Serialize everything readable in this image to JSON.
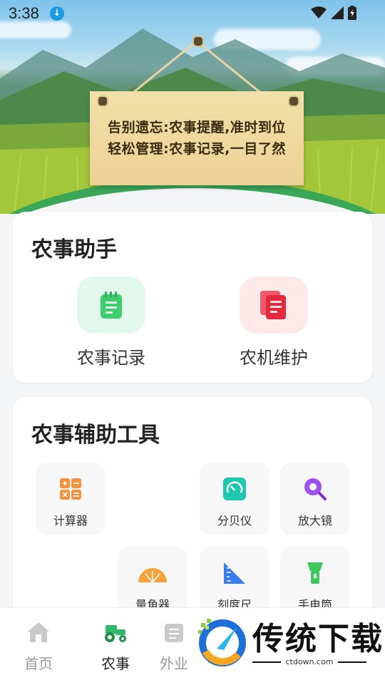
{
  "status_bar": {
    "time": "3:38"
  },
  "banner": {
    "line1": "告别遗忘:农事提醒,准时到位",
    "line2": "轻松管理:农事记录,一目了然"
  },
  "assistant": {
    "title": "农事助手",
    "items": [
      {
        "label": "农事记录",
        "icon": "notebook-icon",
        "color": "#3dcf6e"
      },
      {
        "label": "农机维护",
        "icon": "document-icon",
        "color": "#f0415a"
      }
    ]
  },
  "tools": {
    "title": "农事辅助工具",
    "items": [
      {
        "label": "计算器",
        "icon": "calculator-icon",
        "color": "#f7903a"
      },
      {
        "label": "分贝仪",
        "icon": "decibel-meter-icon",
        "color": "#1fc9b0"
      },
      {
        "label": "放大镜",
        "icon": "magnifier-icon",
        "color": "#a150f0"
      },
      {
        "label": "量角器",
        "icon": "protractor-icon",
        "color": "#f7a23a"
      },
      {
        "label": "刻度尺",
        "icon": "ruler-icon",
        "color": "#3a7cf0"
      },
      {
        "label": "手电筒",
        "icon": "flashlight-icon",
        "color": "#3cc85a"
      }
    ]
  },
  "nav": {
    "items": [
      {
        "label": "首页",
        "icon": "home-icon",
        "active": false
      },
      {
        "label": "农事",
        "icon": "tractor-icon",
        "active": true
      },
      {
        "label": "外业",
        "icon": "field-icon",
        "active": false
      }
    ]
  },
  "watermark": {
    "brand": "传统下载",
    "url": "ctdown.com"
  },
  "colors": {
    "accent_green": "#3aa757",
    "active_nav": "#2fb86a"
  }
}
